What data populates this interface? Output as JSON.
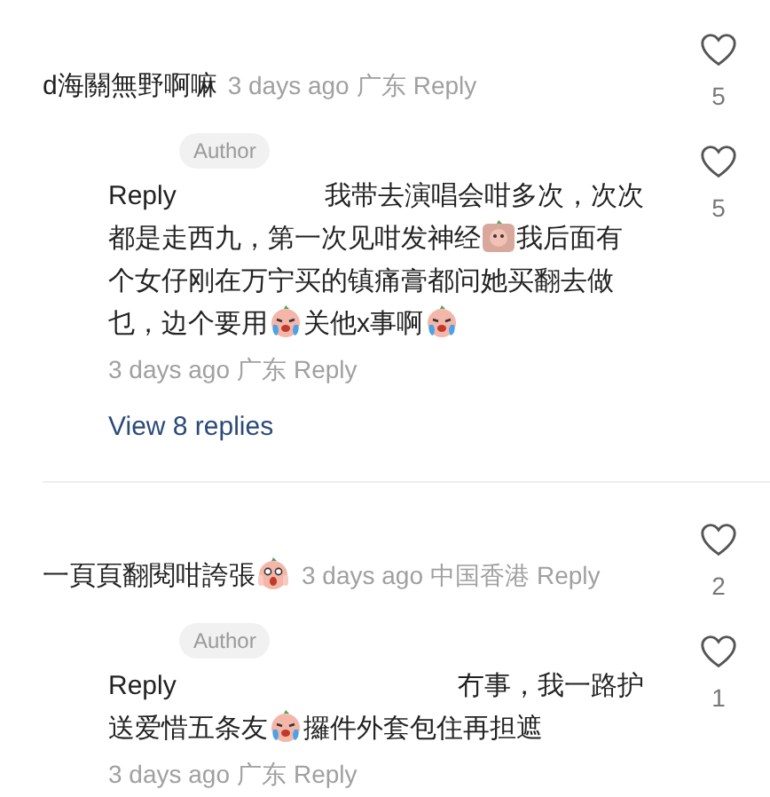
{
  "threads": [
    {
      "comment": {
        "parts": [
          {
            "kind": "text",
            "text": "d海關無野啊嘛"
          }
        ],
        "time": "3 days ago",
        "location": "广东",
        "reply_label": "Reply",
        "likes": "5"
      },
      "replies": [
        {
          "badge": "Author",
          "lead": "Reply",
          "first_line": "我带去演唱会咁多次，次次",
          "parts": [
            {
              "kind": "text",
              "text": "都是走西九，第一次见咁发神经"
            },
            {
              "kind": "blush"
            },
            {
              "kind": "text",
              "text": "我后面有个女仔刚在万宁买的镇痛膏都问她买翻去做乜，边个要用"
            },
            {
              "kind": "crying"
            },
            {
              "kind": "text",
              "text": "关他x事啊"
            },
            {
              "kind": "crying"
            }
          ],
          "time": "3 days ago",
          "location": "广东",
          "reply_label": "Reply",
          "likes": "5"
        }
      ],
      "view_replies": "View 8 replies"
    },
    {
      "comment": {
        "parts": [
          {
            "kind": "text",
            "text": "一頁頁翻閱咁誇張"
          },
          {
            "kind": "scared"
          }
        ],
        "time": "3 days ago",
        "location": "中国香港",
        "reply_label": "Reply",
        "likes": "2"
      },
      "replies": [
        {
          "badge": "Author",
          "lead": "Reply",
          "first_line": "冇事，我一路护",
          "parts": [
            {
              "kind": "text",
              "text": "送爱惜五条友"
            },
            {
              "kind": "crying"
            },
            {
              "kind": "text",
              "text": "攞件外套包住再担遮"
            }
          ],
          "time": "3 days ago",
          "location": "广东",
          "reply_label": "Reply",
          "likes": "1"
        }
      ]
    }
  ]
}
